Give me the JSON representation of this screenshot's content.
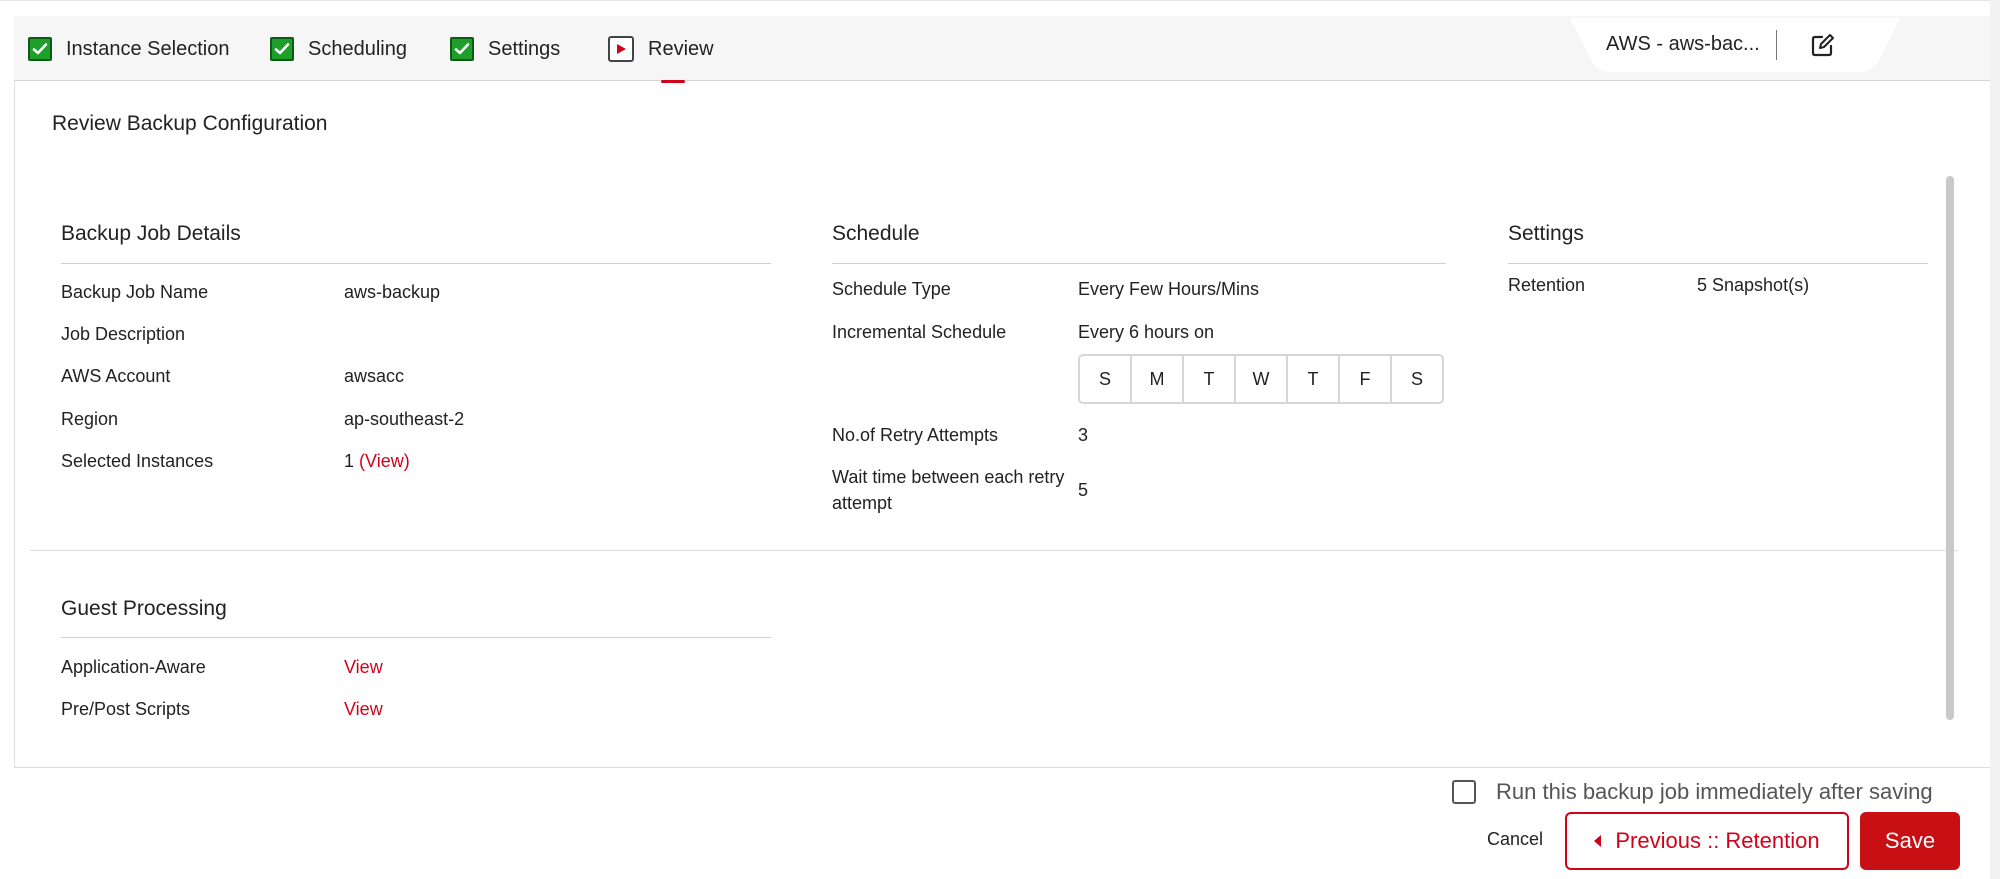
{
  "colors": {
    "accent": "#d0021b",
    "check": "#1e9e2a",
    "save_bg": "#c80f14"
  },
  "wizard": {
    "steps": [
      {
        "label": "Instance Selection",
        "state": "done",
        "icon": "check-icon"
      },
      {
        "label": "Scheduling",
        "state": "done",
        "icon": "check-icon"
      },
      {
        "label": "Settings",
        "state": "done",
        "icon": "check-icon"
      },
      {
        "label": "Review",
        "state": "active",
        "icon": "play-icon"
      }
    ],
    "job_tab": {
      "name": "AWS - aws-bac...",
      "edit_icon": "edit-icon"
    }
  },
  "page": {
    "title": "Review Backup Configuration"
  },
  "backup_job": {
    "title": "Backup Job Details",
    "rows": [
      {
        "label": "Backup Job Name",
        "value": "aws-backup"
      },
      {
        "label": "Job Description",
        "value": ""
      },
      {
        "label": "AWS Account",
        "value": "awsacc"
      },
      {
        "label": "Region",
        "value": "ap-southeast-2"
      },
      {
        "label": "Selected Instances",
        "value": "1",
        "link": "(View)"
      }
    ]
  },
  "schedule": {
    "title": "Schedule",
    "type_label": "Schedule Type",
    "type_value": "Every Few Hours/Mins",
    "incremental_label": "Incremental Schedule",
    "incremental_value": "Every 6 hours on",
    "days": [
      "S",
      "M",
      "T",
      "W",
      "T",
      "F",
      "S"
    ],
    "retry_label": "No.of Retry Attempts",
    "retry_value": "3",
    "wait_label": "Wait time between each retry attempt",
    "wait_value": "5"
  },
  "settings": {
    "title": "Settings",
    "retention_label": "Retention",
    "retention_value": "5 Snapshot(s)"
  },
  "guest_processing": {
    "title": "Guest Processing",
    "rows": [
      {
        "label": "Application-Aware",
        "link": "View"
      },
      {
        "label": "Pre/Post Scripts",
        "link": "View"
      }
    ]
  },
  "footer": {
    "run_immediately_label": "Run this backup job immediately after saving",
    "run_immediately_checked": false,
    "cancel_label": "Cancel",
    "previous_label": "Previous :: Retention",
    "save_label": "Save"
  }
}
